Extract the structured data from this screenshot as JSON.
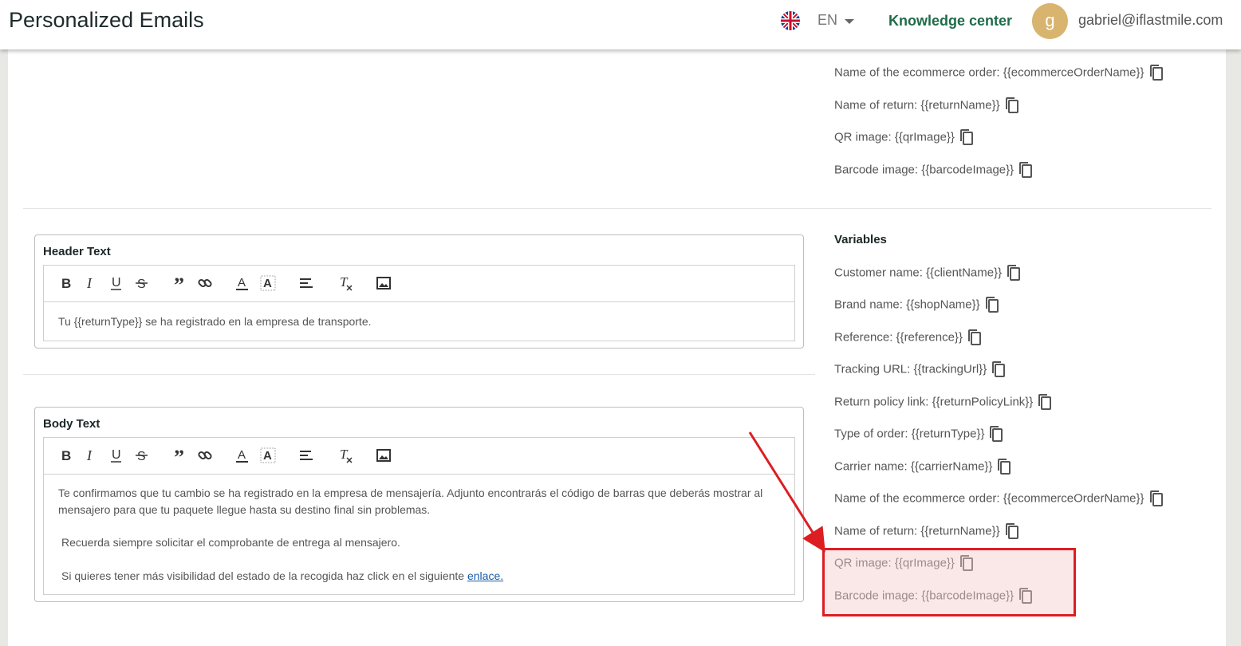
{
  "header": {
    "title": "Personalized Emails",
    "language": "EN",
    "flag_icon": "uk-flag-icon",
    "knowledge_center": "Knowledge center",
    "avatar_letter": "g",
    "user_email": "gabriel@iflastmile.com"
  },
  "top_variables": [
    {
      "label": "Name of the ecommerce order:",
      "token": "{{ecommerceOrderName}}"
    },
    {
      "label": "Name of return:",
      "token": "{{returnName}}"
    },
    {
      "label": "QR image:",
      "token": "{{qrImage}}"
    },
    {
      "label": "Barcode image:",
      "token": "{{barcodeImage}}"
    }
  ],
  "variables": {
    "title": "Variables",
    "items": [
      {
        "label": "Customer name:",
        "token": "{{clientName}}"
      },
      {
        "label": "Brand name:",
        "token": "{{shopName}}"
      },
      {
        "label": "Reference:",
        "token": "{{reference}}"
      },
      {
        "label": "Tracking URL:",
        "token": "{{trackingUrl}}"
      },
      {
        "label": "Return policy link:",
        "token": "{{returnPolicyLink}}"
      },
      {
        "label": "Type of order:",
        "token": "{{returnType}}"
      },
      {
        "label": "Carrier name:",
        "token": "{{carrierName}}"
      },
      {
        "label": "Name of the ecommerce order:",
        "token": "{{ecommerceOrderName}}"
      },
      {
        "label": "Name of return:",
        "token": "{{returnName}}"
      },
      {
        "label": "QR image:",
        "token": "{{qrImage}}"
      },
      {
        "label": "Barcode image:",
        "token": "{{barcodeImage}}"
      }
    ]
  },
  "header_text": {
    "title": "Header Text",
    "content": "Tu {{returnType}} se ha registrado en la empresa de transporte."
  },
  "body_text": {
    "title": "Body Text",
    "paragraph1": "Te confirmamos que tu cambio se ha registrado en la empresa de mensajería. Adjunto encontrarás el código de barras que deberás mostrar al mensajero para que tu paquete llegue hasta su destino final sin problemas.",
    "paragraph2": "Recuerda siempre solicitar el comprobante de entrega al mensajero.",
    "paragraph3_prefix": "Si quieres tener más visibilidad del estado de la recogida haz click en el siguiente",
    "paragraph3_link": "enlace."
  },
  "toolbar_icons": [
    "bold-icon",
    "italic-icon",
    "underline-icon",
    "strikethrough-icon",
    "blockquote-icon",
    "link-icon",
    "text-color-icon",
    "background-color-icon",
    "align-icon",
    "clear-format-icon",
    "image-icon"
  ],
  "colors": {
    "brand_green": "#1f6b4a",
    "avatar_bg": "#d9b46e",
    "highlight_border": "#dc1e22",
    "link_blue": "#1a5ba8"
  }
}
